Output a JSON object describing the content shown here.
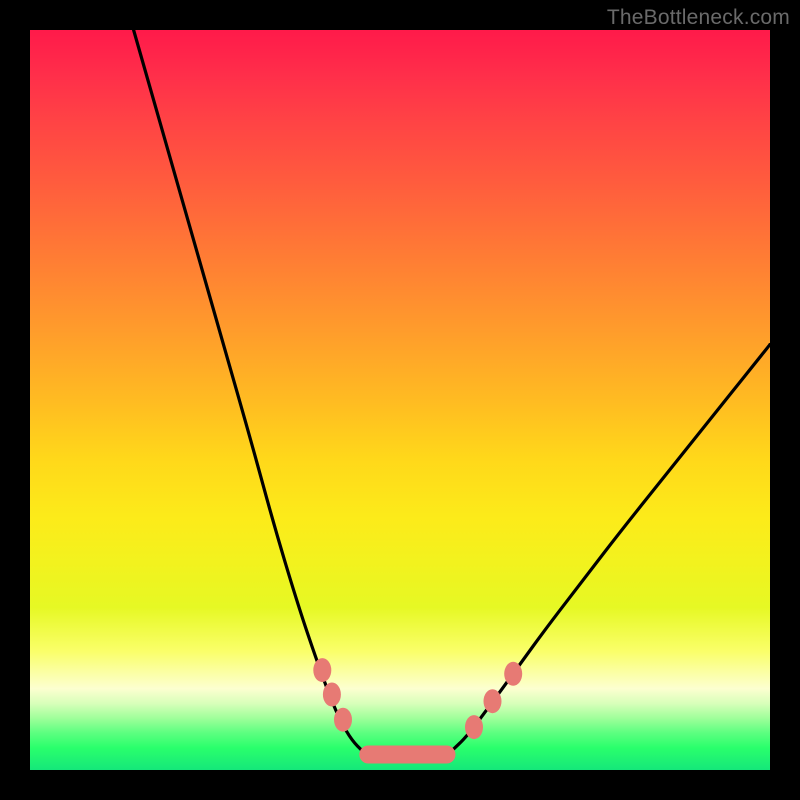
{
  "watermark": "TheBottleneck.com",
  "colors": {
    "marker": "#e77a74",
    "curve": "#000000"
  },
  "chart_data": {
    "type": "line",
    "title": "",
    "xlabel": "",
    "ylabel": "",
    "xlim": [
      0,
      100
    ],
    "ylim": [
      0,
      100
    ],
    "grid": false,
    "series": [
      {
        "name": "left-branch",
        "x": [
          14,
          18,
          22,
          26,
          30,
          33,
          36,
          38.5,
          40.5,
          42,
          43.5,
          45
        ],
        "y": [
          100,
          86,
          72,
          58,
          44,
          33,
          23,
          15.5,
          10,
          6.5,
          4,
          2.5
        ]
      },
      {
        "name": "valley-floor",
        "x": [
          45,
          47,
          49,
          51,
          53,
          55,
          57
        ],
        "y": [
          2.5,
          2.0,
          1.8,
          1.8,
          2.0,
          2.2,
          2.6
        ]
      },
      {
        "name": "right-branch",
        "x": [
          57,
          59,
          62,
          66,
          70,
          75,
          80,
          86,
          92,
          98,
          100
        ],
        "y": [
          2.6,
          4.5,
          8.5,
          14,
          19.5,
          26,
          32.5,
          40,
          47.5,
          55,
          57.5
        ]
      }
    ],
    "markers": {
      "name": "highlight-points",
      "points": [
        {
          "x": 39.5,
          "y": 13.5
        },
        {
          "x": 40.8,
          "y": 10.2
        },
        {
          "x": 42.3,
          "y": 6.8
        },
        {
          "x": 60.0,
          "y": 5.8
        },
        {
          "x": 62.5,
          "y": 9.3
        },
        {
          "x": 65.3,
          "y": 13.0
        }
      ],
      "pill": {
        "x0": 44.5,
        "x1": 57.5,
        "y": 2.1
      }
    }
  }
}
